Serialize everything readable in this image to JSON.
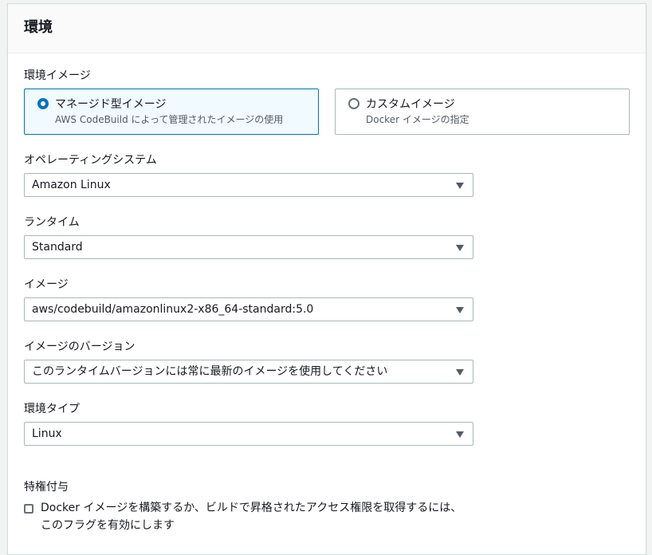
{
  "panel": {
    "title": "環境"
  },
  "environment_image": {
    "label": "環境イメージ",
    "options": [
      {
        "title": "マネージド型イメージ",
        "description": "AWS CodeBuild によって管理されたイメージの使用",
        "selected": true
      },
      {
        "title": "カスタムイメージ",
        "description": "Docker イメージの指定",
        "selected": false
      }
    ]
  },
  "operating_system": {
    "label": "オペレーティングシステム",
    "value": "Amazon Linux"
  },
  "runtime": {
    "label": "ランタイム",
    "value": "Standard"
  },
  "image": {
    "label": "イメージ",
    "value": "aws/codebuild/amazonlinux2-x86_64-standard:5.0"
  },
  "image_version": {
    "label": "イメージのバージョン",
    "value": "このランタイムバージョンには常に最新のイメージを使用してください"
  },
  "environment_type": {
    "label": "環境タイプ",
    "value": "Linux"
  },
  "privileged": {
    "label": "特権付与",
    "checkbox_text": "Docker イメージを構築するか、ビルドで昇格されたアクセス権限を取得するには、このフラグを有効にします",
    "checked": false
  },
  "colors": {
    "accent": "#0073bb",
    "selected_tile_bg": "#f1faff",
    "border": "#aab7b8",
    "header_bg": "#fafafa"
  },
  "icons": {
    "dropdown": "caret-down-icon"
  }
}
